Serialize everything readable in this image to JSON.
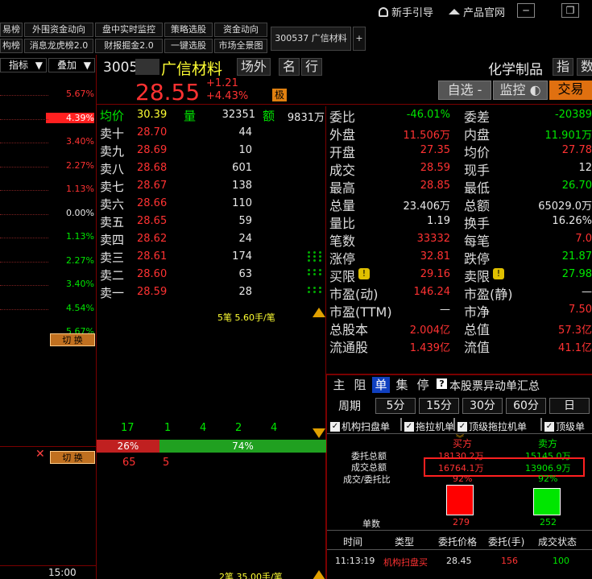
{
  "topbar": {
    "guide": "新手引导",
    "official": "产品官网",
    "guide_icon": "bell-icon",
    "home_icon": "home-icon"
  },
  "nav": {
    "row1": [
      "易榜",
      "外围资金动向",
      "盘中实时监控",
      "策略选股",
      "资金动向"
    ],
    "row2": [
      "构榜",
      "消息龙虎榜2.0",
      "财报掘金2.0",
      "一键选股",
      "市场全景图"
    ],
    "tab_label": "300537 广信材料",
    "add": "+"
  },
  "left": {
    "indicator": "指标",
    "overlay": "叠加",
    "pcts": [
      {
        "v": "5.67%",
        "c": "red"
      },
      {
        "v": "4.39%",
        "c": "hl"
      },
      {
        "v": "3.40%",
        "c": "red"
      },
      {
        "v": "2.27%",
        "c": "red"
      },
      {
        "v": "1.13%",
        "c": "red"
      },
      {
        "v": "0.00%",
        "c": "white"
      },
      {
        "v": "1.13%",
        "c": "green"
      },
      {
        "v": "2.27%",
        "c": "green"
      },
      {
        "v": "3.40%",
        "c": "green"
      },
      {
        "v": "4.54%",
        "c": "green"
      },
      {
        "v": "5.67%",
        "c": "green"
      }
    ],
    "switch1": "切 换",
    "switch2": "切 换",
    "time": "15:00"
  },
  "header": {
    "code": "3005",
    "name": "广信材料",
    "tag1": "场外",
    "tag2": "名",
    "tag3": "行",
    "sector": "化学制品",
    "sector_btn": "指",
    "sector_btn2": "数",
    "price": "28.55",
    "change": "+1.21",
    "change_pct": "+4.43%",
    "badge": "极",
    "watch": "自选",
    "monitor": "监控",
    "trade": "交易"
  },
  "book": {
    "avg_label": "均价",
    "avg": "30.39",
    "vol_label": "量",
    "vol": "32351",
    "amt_label": "额",
    "amt": "9831万",
    "sells": [
      {
        "label": "卖十",
        "price": "28.70",
        "vol": "44"
      },
      {
        "label": "卖九",
        "price": "28.69",
        "vol": "10"
      },
      {
        "label": "卖八",
        "price": "28.68",
        "vol": "601"
      },
      {
        "label": "卖七",
        "price": "28.67",
        "vol": "138"
      },
      {
        "label": "卖六",
        "price": "28.66",
        "vol": "110"
      },
      {
        "label": "卖五",
        "price": "28.65",
        "vol": "59"
      },
      {
        "label": "卖四",
        "price": "28.62",
        "vol": "24"
      },
      {
        "label": "卖三",
        "price": "28.61",
        "vol": "174"
      },
      {
        "label": "卖二",
        "price": "28.60",
        "vol": "63"
      },
      {
        "label": "卖一",
        "price": "28.59",
        "vol": "28"
      }
    ]
  },
  "ticks": {
    "top_note": "5笔 5.60手/笔",
    "nums": [
      "17",
      "1",
      "4",
      "2",
      "4"
    ],
    "ratio_left": "26%",
    "ratio_right": "74%",
    "ratio_left_value": 26,
    "bot_left": "65",
    "bot_right": "5",
    "bottom_note": "2笔 35.00手/笔"
  },
  "stats": {
    "rows": [
      {
        "l": "委比",
        "v": "-46.01%",
        "vc": "green",
        "l2": "委差",
        "v2": "-20389",
        "v2c": "green"
      },
      {
        "l": "外盘",
        "v": "11.506万",
        "vc": "red",
        "l2": "内盘",
        "v2": "11.901万",
        "v2c": "green"
      },
      {
        "l": "开盘",
        "v": "27.35",
        "vc": "red",
        "l2": "均价",
        "v2": "27.78",
        "v2c": "red"
      },
      {
        "l": "成交",
        "v": "28.59",
        "vc": "red",
        "l2": "现手",
        "v2": "12",
        "v2c": "white"
      },
      {
        "l": "最高",
        "v": "28.85",
        "vc": "red",
        "l2": "最低",
        "v2": "26.70",
        "v2c": "green"
      },
      {
        "l": "总量",
        "v": "23.406万",
        "vc": "white",
        "l2": "总额",
        "v2": "65029.0万",
        "v2c": "white"
      },
      {
        "l": "量比",
        "v": "1.19",
        "vc": "white",
        "l2": "换手",
        "v2": "16.26%",
        "v2c": "white"
      },
      {
        "l": "笔数",
        "v": "33332",
        "vc": "red",
        "l2": "每笔",
        "v2": "7.0",
        "v2c": "red"
      },
      {
        "l": "涨停",
        "v": "32.81",
        "vc": "red",
        "l2": "跌停",
        "v2": "21.87",
        "v2c": "green"
      },
      {
        "l": "买限",
        "v": "29.16",
        "vc": "red",
        "l2": "卖限",
        "v2": "27.98",
        "v2c": "green",
        "warn": true
      },
      {
        "l": "市盈(动)",
        "v": "146.24",
        "vc": "red",
        "l2": "市盈(静)",
        "v2": "—",
        "v2c": "white"
      },
      {
        "l": "市盈(TTM)",
        "v": "—",
        "vc": "white",
        "l2": "市净",
        "v2": "7.50",
        "v2c": "red"
      },
      {
        "l": "总股本",
        "v": "2.004亿",
        "vc": "red",
        "l2": "总值",
        "v2": "57.3亿",
        "v2c": "red"
      },
      {
        "l": "流通股",
        "v": "1.439亿",
        "vc": "red",
        "l2": "流值",
        "v2": "41.1亿",
        "v2c": "red"
      }
    ]
  },
  "lower": {
    "tabs": [
      "主",
      "阻",
      "单",
      "集",
      "停"
    ],
    "active_tab": 2,
    "title": "本股票异动单汇总",
    "period_label": "周期",
    "periods": [
      "5分",
      "15分",
      "30分",
      "60分",
      "日"
    ],
    "checks": [
      "机构扫盘单",
      "拖拉机单",
      "顶级拖拉机单",
      "顶级单"
    ],
    "buy_label": "买方",
    "sell_label": "卖方",
    "row1_label": "委托总额",
    "row1_buy": "18130.2万",
    "row1_sell": "15145.0万",
    "row2_label": "成交总额",
    "row2_buy": "16764.1万",
    "row2_sell": "13906.9万",
    "row3_label": "成交/委托比",
    "row3_buy": "92%",
    "row3_sell": "92%",
    "count_label": "单数",
    "buy_count": "279",
    "sell_count": "252",
    "table_headers": [
      "时间",
      "类型",
      "委托价格",
      "委托(手)",
      "成交状态"
    ],
    "table_rows": [
      {
        "time": "11:13:19",
        "type": "机构扫盘买",
        "price": "28.45",
        "qty": "156",
        "status": "100"
      }
    ],
    "colors": {
      "buy": "#ff0000",
      "sell": "#00e600"
    }
  }
}
